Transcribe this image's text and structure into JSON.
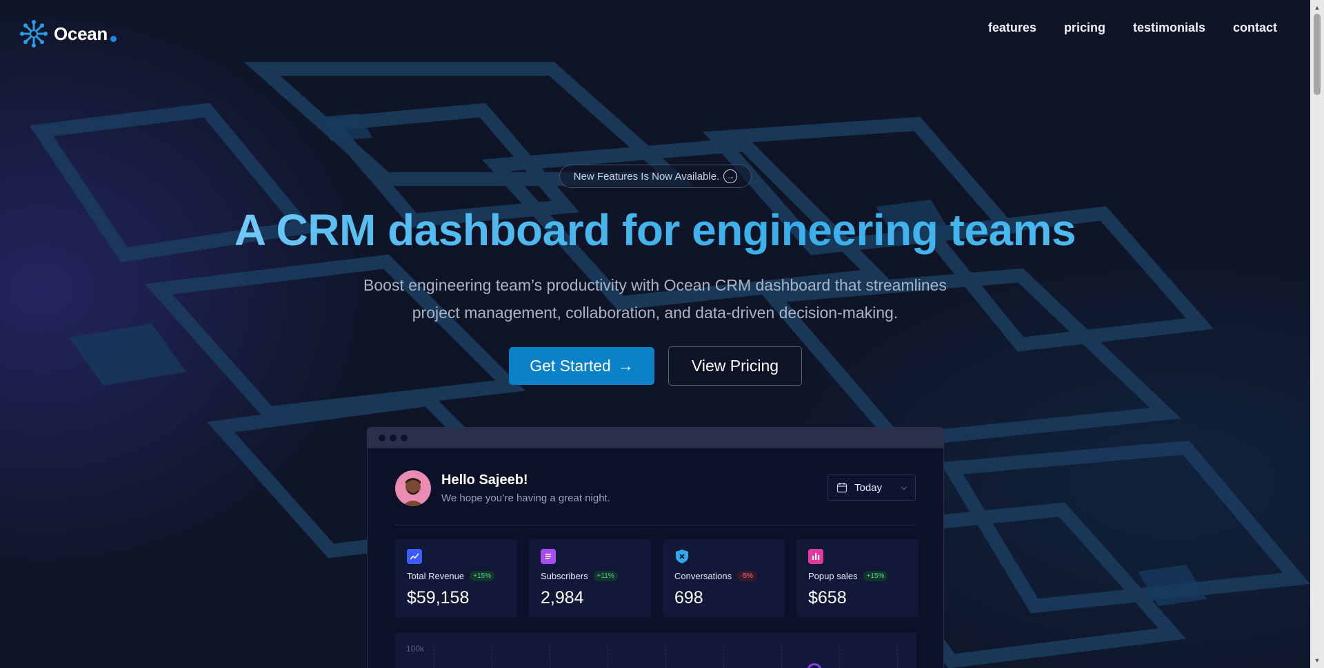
{
  "brand": {
    "name": "Ocean",
    "accent": "#1e88e5"
  },
  "nav": [
    {
      "label": "features"
    },
    {
      "label": "pricing"
    },
    {
      "label": "testimonials"
    },
    {
      "label": "contact"
    }
  ],
  "hero": {
    "badge": "New Features Is Now Available.",
    "badge_icon": "arrow-circle-right-icon",
    "title": "A CRM dashboard for engineering teams",
    "subtitle_line1": "Boost engineering team’s productivity with Ocean CRM dashboard that streamlines",
    "subtitle_line2": "project management, collaboration, and data-driven decision-making.",
    "primary_cta": "Get Started",
    "primary_cta_arrow": "→",
    "secondary_cta": "View Pricing"
  },
  "dashboard": {
    "greeting": "Hello Sajeeb!",
    "greeting_sub": "We hope you’re having a great night.",
    "date_filter": "Today",
    "stats": [
      {
        "label": "Total Revenue",
        "change": "+15%",
        "direction": "up",
        "value": "$59,158",
        "icon": "chart-line-icon",
        "color": "#3b5bff"
      },
      {
        "label": "Subscribers",
        "change": "+11%",
        "direction": "up",
        "value": "2,984",
        "icon": "document-list-icon",
        "color": "#a84df0"
      },
      {
        "label": "Conversations",
        "change": "-5%",
        "direction": "down",
        "value": "698",
        "icon": "shield-x-icon",
        "color": "#2fa8ee"
      },
      {
        "label": "Popup sales",
        "change": "+15%",
        "direction": "up",
        "value": "$658",
        "icon": "bar-chart-icon",
        "color": "#e03aa0"
      }
    ],
    "chart_top_label": "100k"
  }
}
